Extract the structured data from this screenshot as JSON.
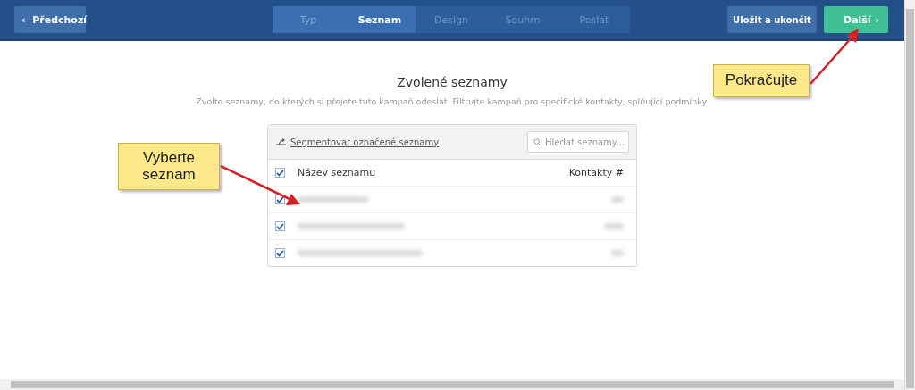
{
  "toolbar": {
    "back_button": {
      "label": "Předchozí",
      "icon": "‹"
    },
    "steps": [
      {
        "label": "Typ",
        "selected": false,
        "done": true
      },
      {
        "label": "Seznam",
        "selected": true,
        "done": false
      },
      {
        "label": "Design",
        "selected": false,
        "done": false
      },
      {
        "label": "Souhrn",
        "selected": false,
        "done": false
      },
      {
        "label": "Poslat",
        "selected": false,
        "done": false
      }
    ],
    "save_button": "Uložit a ukončit",
    "next_button": {
      "label": "Další",
      "icon": "›"
    }
  },
  "heading": "Zvolené seznamy",
  "description": "Zvolte seznamy, do kterých si přejete tuto kampaň odeslat. Filtrujte kampaň pro specifické kontakty, splňující podmínky.",
  "list_panel": {
    "segment_link": "Segmentovat označené seznamy",
    "search": {
      "placeholder": "Hledat seznamy..."
    },
    "columns": [
      "Název seznamu",
      "Kontakty #"
    ],
    "all_checked": true,
    "rows": [
      {
        "checked": true
      },
      {
        "checked": true
      },
      {
        "checked": true
      }
    ]
  },
  "callouts": [
    {
      "text": "Vyberte seznam"
    },
    {
      "text": "Pokračujte"
    }
  ]
}
